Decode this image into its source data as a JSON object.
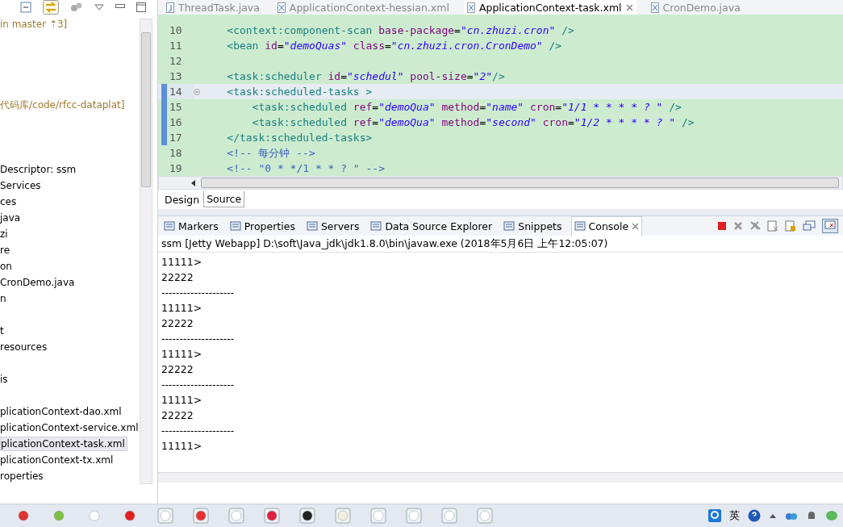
{
  "explorer": {
    "items": [
      {
        "label": "in master ⇡3]",
        "kind": "git"
      },
      {
        "label": "代码库/code/rfcc-dataplat]",
        "kind": "git"
      },
      {
        "label": "Descriptor: ssm",
        "kind": "node",
        "selected": false
      },
      {
        "label": "Services",
        "kind": "node",
        "selected": false
      },
      {
        "label": "ces",
        "kind": "node",
        "selected": false
      },
      {
        "label": "java",
        "kind": "node",
        "selected": false
      },
      {
        "label": "zi",
        "kind": "node",
        "selected": false
      },
      {
        "label": "re",
        "kind": "node",
        "selected": false
      },
      {
        "label": "on",
        "kind": "node",
        "selected": false
      },
      {
        "label": "CronDemo.java",
        "kind": "node",
        "selected": false
      },
      {
        "label": "n",
        "kind": "node",
        "selected": false
      },
      {
        "label": "t",
        "kind": "node",
        "selected": false
      },
      {
        "label": "resources",
        "kind": "node",
        "selected": false
      },
      {
        "label": "is",
        "kind": "node",
        "selected": false
      },
      {
        "label": "plicationContext-dao.xml",
        "kind": "node",
        "selected": false
      },
      {
        "label": "plicationContext-service.xml",
        "kind": "node",
        "selected": false
      },
      {
        "label": "plicationContext-task.xml",
        "kind": "node",
        "selected": true
      },
      {
        "label": "plicationContext-tx.xml",
        "kind": "node",
        "selected": false
      },
      {
        "label": "roperties",
        "kind": "node",
        "selected": false
      }
    ]
  },
  "editor": {
    "tabs": [
      {
        "label": "ThreadTask.java",
        "selected": false
      },
      {
        "label": "ApplicationContext-hessian.xml",
        "selected": false
      },
      {
        "label": "ApplicationContext-task.xml",
        "selected": true
      },
      {
        "label": "CronDemo.java",
        "selected": false
      }
    ],
    "lines": [
      {
        "number": "10",
        "current": false,
        "changed": false,
        "tokens": [
          {
            "kind": "tag",
            "text": "    <context:component-scan "
          },
          {
            "kind": "attr",
            "text": "base-package"
          },
          {
            "kind": "plain",
            "text": "="
          },
          {
            "kind": "value",
            "text": "\"cn.zhuzi.cron\""
          },
          {
            "kind": "tag",
            "text": " />"
          }
        ]
      },
      {
        "number": "11",
        "current": false,
        "changed": false,
        "tokens": [
          {
            "kind": "tag",
            "text": "    <bean "
          },
          {
            "kind": "attr",
            "text": "id"
          },
          {
            "kind": "plain",
            "text": "="
          },
          {
            "kind": "value",
            "text": "\"demoQuas\""
          },
          {
            "kind": "attr",
            "text": " class"
          },
          {
            "kind": "plain",
            "text": "="
          },
          {
            "kind": "value",
            "text": "\"cn.zhuzi.cron.CronDemo\""
          },
          {
            "kind": "tag",
            "text": " />"
          }
        ]
      },
      {
        "number": "12",
        "current": false,
        "changed": false
      },
      {
        "number": "13",
        "current": false,
        "changed": false,
        "tokens": [
          {
            "kind": "tag",
            "text": "    <task:scheduler "
          },
          {
            "kind": "attr",
            "text": "id"
          },
          {
            "kind": "plain",
            "text": "="
          },
          {
            "kind": "value",
            "text": "\"schedul\""
          },
          {
            "kind": "attr",
            "text": " pool-size"
          },
          {
            "kind": "plain",
            "text": "="
          },
          {
            "kind": "value",
            "text": "\"2\""
          },
          {
            "kind": "tag",
            "text": "/>"
          }
        ]
      },
      {
        "number": "14",
        "current": true,
        "changed": true,
        "tokens": [
          {
            "kind": "tag",
            "text": "    <task:scheduled-tasks >"
          }
        ]
      },
      {
        "number": "15",
        "current": false,
        "changed": true,
        "tokens": [
          {
            "kind": "tag",
            "text": "        <task:scheduled "
          },
          {
            "kind": "attr",
            "text": "ref"
          },
          {
            "kind": "plain",
            "text": "="
          },
          {
            "kind": "value",
            "text": "\"demoQua\""
          },
          {
            "kind": "attr",
            "text": " method"
          },
          {
            "kind": "plain",
            "text": "="
          },
          {
            "kind": "value",
            "text": "\"name\""
          },
          {
            "kind": "attr",
            "text": " cron"
          },
          {
            "kind": "plain",
            "text": "="
          },
          {
            "kind": "value",
            "text": "\"1/1 * * * * ? \""
          },
          {
            "kind": "tag",
            "text": " />"
          }
        ]
      },
      {
        "number": "16",
        "current": false,
        "changed": true,
        "tokens": [
          {
            "kind": "tag",
            "text": "        <task:scheduled "
          },
          {
            "kind": "attr",
            "text": "ref"
          },
          {
            "kind": "plain",
            "text": "="
          },
          {
            "kind": "value",
            "text": "\"demoQua\""
          },
          {
            "kind": "attr",
            "text": " method"
          },
          {
            "kind": "plain",
            "text": "="
          },
          {
            "kind": "value",
            "text": "\"second\""
          },
          {
            "kind": "attr",
            "text": " cron"
          },
          {
            "kind": "plain",
            "text": "="
          },
          {
            "kind": "value",
            "text": "\"1/2 * * * * ? \""
          },
          {
            "kind": "tag",
            "text": " />"
          }
        ]
      },
      {
        "number": "17",
        "current": false,
        "changed": true,
        "tokens": [
          {
            "kind": "tag",
            "text": "    </task:scheduled-tasks>"
          }
        ]
      },
      {
        "number": "18",
        "current": false,
        "changed": false,
        "tokens": [
          {
            "kind": "comment",
            "text": "    <!-- 每分钟 -->"
          }
        ]
      },
      {
        "number": "19",
        "current": false,
        "changed": false,
        "tokens": [
          {
            "kind": "comment",
            "text": "    <!-- \"0 * */1 * * ? \" -->"
          }
        ]
      }
    ],
    "mode_tabs": [
      {
        "label": "Design",
        "selected": false
      },
      {
        "label": "Source",
        "selected": true
      }
    ]
  },
  "views": {
    "tabs": [
      {
        "label": "Markers",
        "selected": false
      },
      {
        "label": "Properties",
        "selected": false
      },
      {
        "label": "Servers",
        "selected": false
      },
      {
        "label": "Data Source Explorer",
        "selected": false
      },
      {
        "label": "Snippets",
        "selected": false
      },
      {
        "label": "Console",
        "selected": true
      }
    ]
  },
  "console": {
    "title": "ssm [Jetty Webapp] D:\\soft\\Java_jdk\\jdk1.8.0\\bin\\javaw.exe (2018年5月6日 上午12:05:07)",
    "output": [
      "11111>",
      "22222",
      "--------------------",
      "11111>",
      "22222",
      "--------------------",
      "11111>",
      "22222",
      "--------------------",
      "11111>",
      "22222",
      "--------------------",
      "11111>"
    ]
  },
  "taskbar": {
    "ime": "英"
  }
}
